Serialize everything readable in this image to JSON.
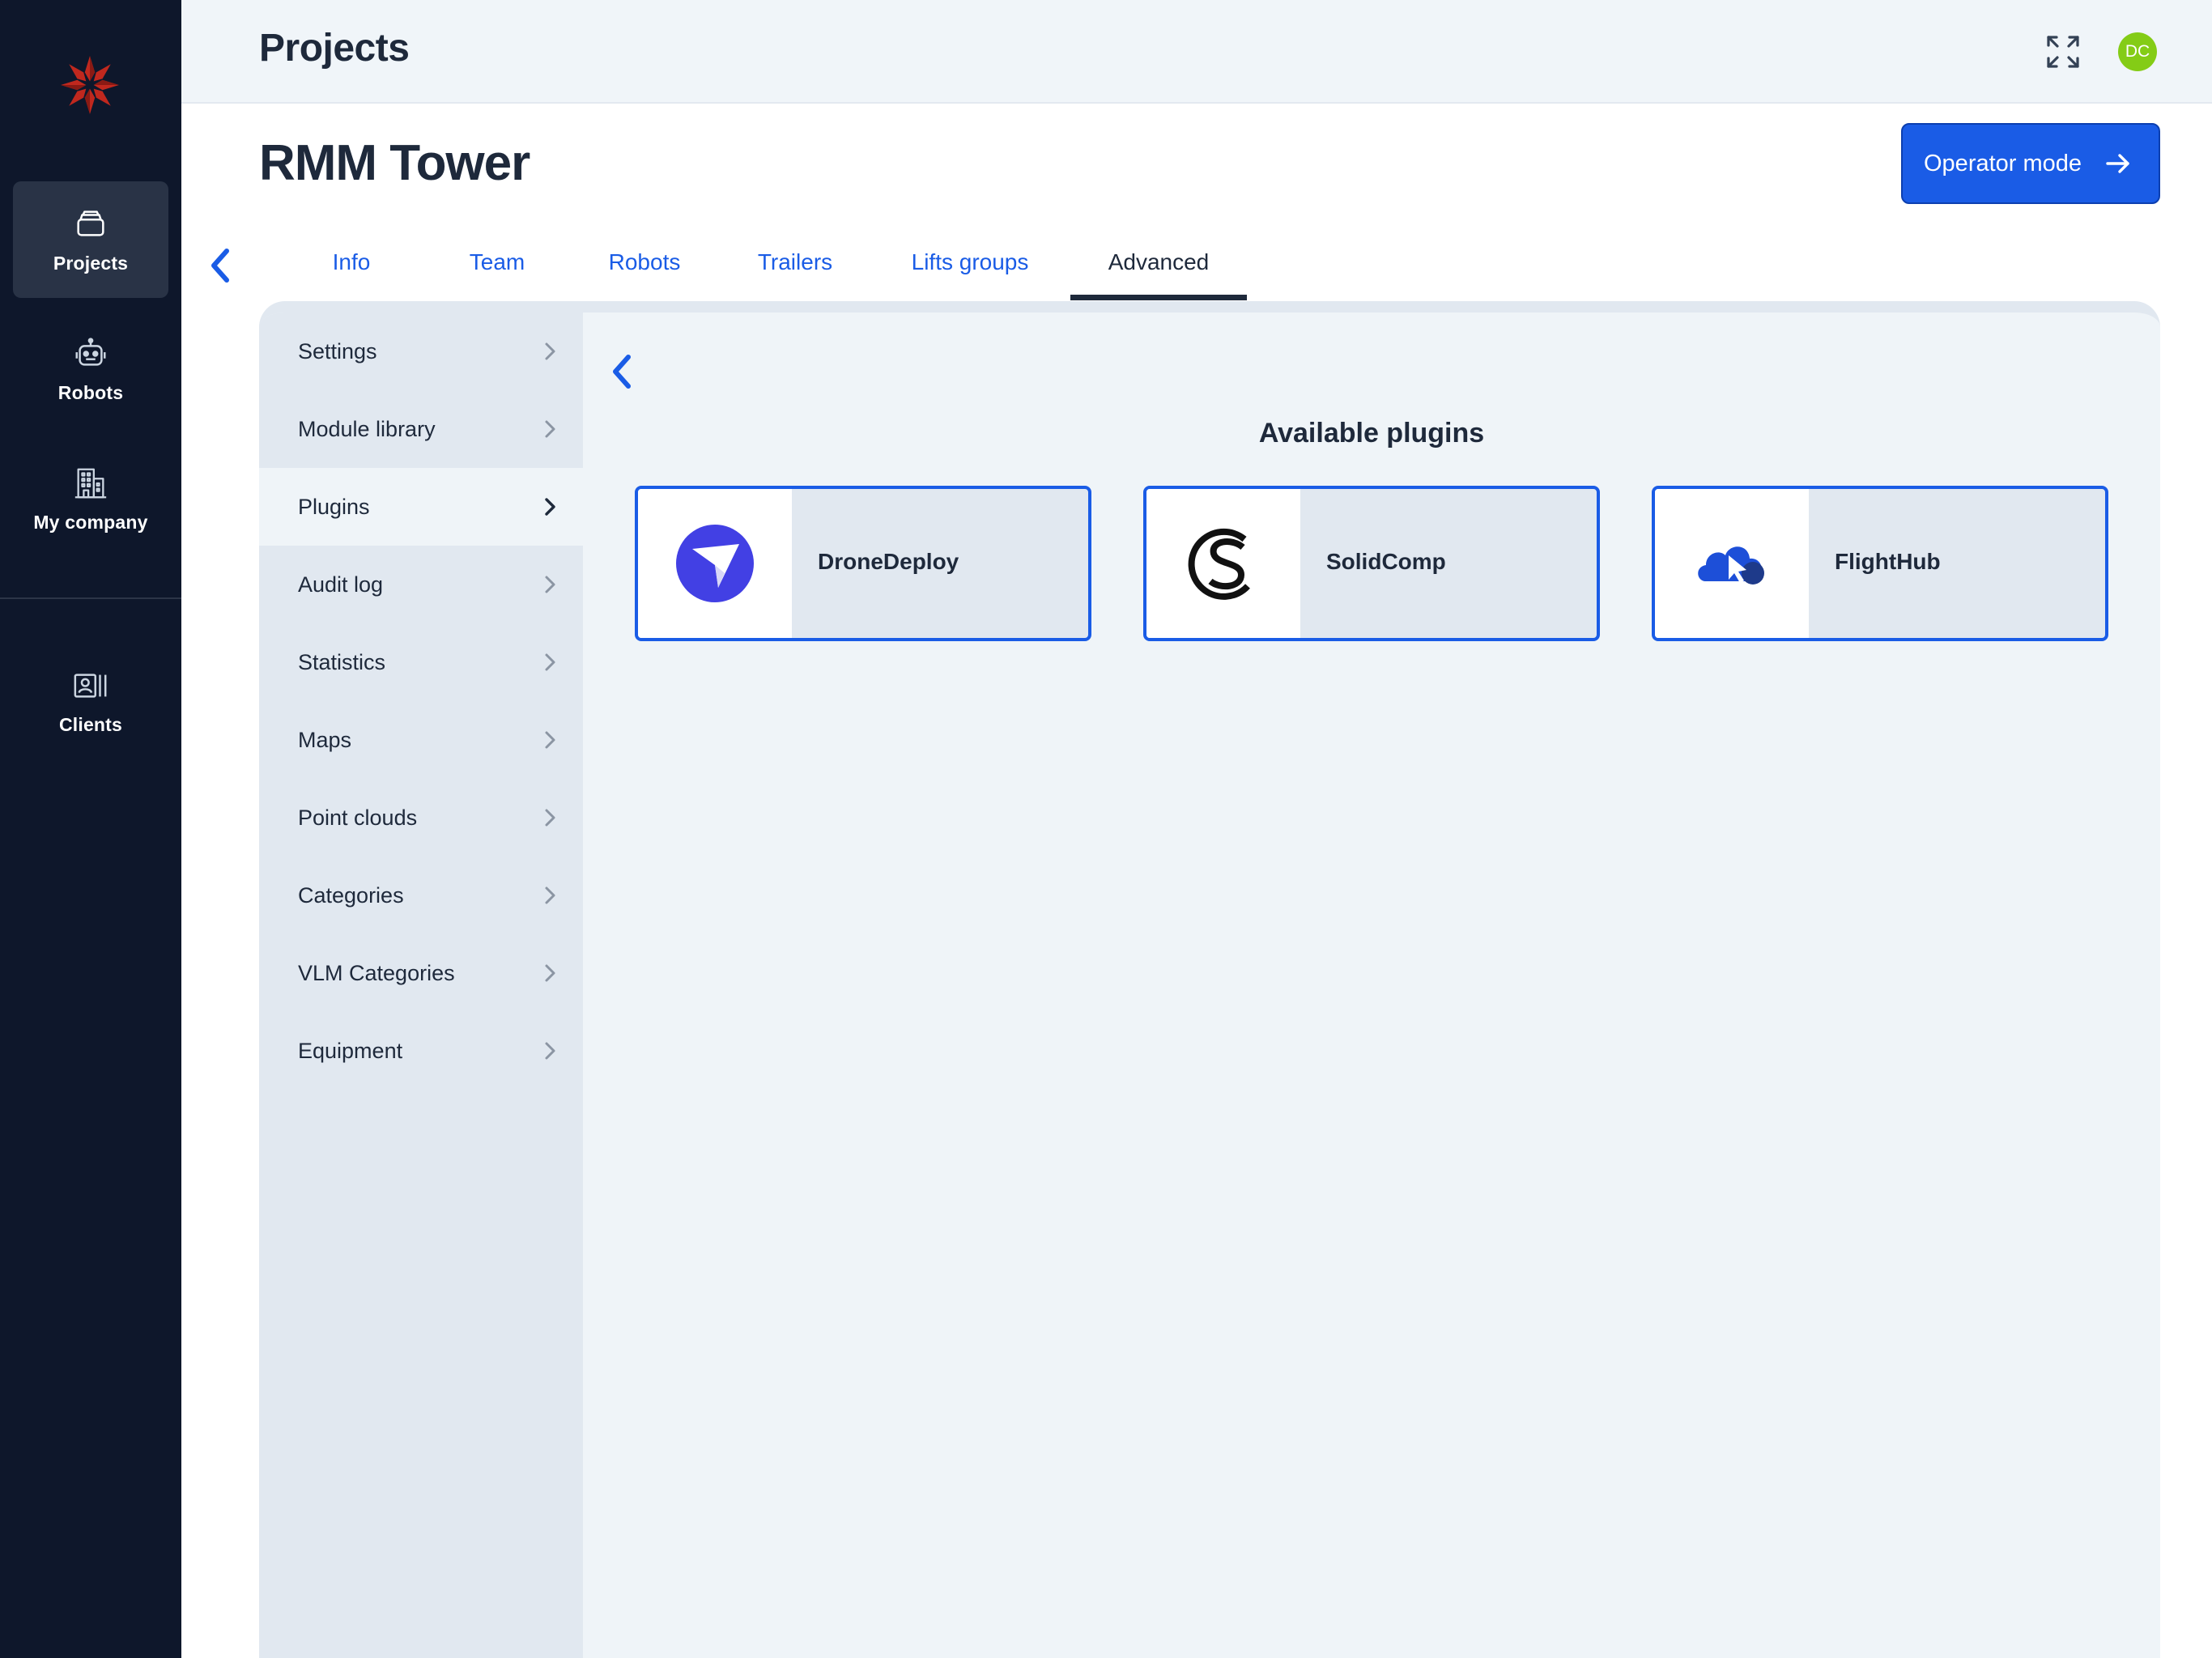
{
  "colors": {
    "rail_bg": "#0e172b",
    "accent": "#1a5ce6",
    "avatar_bg": "#84cc16",
    "logo_red": "#c0281e"
  },
  "rail": {
    "logo_icon": "snowflake-logo",
    "items": [
      {
        "label": "Projects",
        "icon": "folder-stack-icon",
        "active": true
      },
      {
        "label": "Robots",
        "icon": "robot-icon",
        "active": false
      },
      {
        "label": "My company",
        "icon": "building-icon",
        "active": false
      },
      {
        "label": "Clients",
        "icon": "contact-card-icon",
        "active": false
      }
    ]
  },
  "topbar": {
    "title": "Projects",
    "fullscreen_icon": "expand-icon",
    "avatar_initials": "DC"
  },
  "header": {
    "project_name": "RMM Tower",
    "operator_button": "Operator mode"
  },
  "tabs": [
    {
      "label": "Info",
      "active": false
    },
    {
      "label": "Team",
      "active": false
    },
    {
      "label": "Robots",
      "active": false
    },
    {
      "label": "Trailers",
      "active": false
    },
    {
      "label": "Lifts groups",
      "active": false
    },
    {
      "label": "Advanced",
      "active": true
    }
  ],
  "submenu": [
    {
      "label": "Settings",
      "active": false
    },
    {
      "label": "Module library",
      "active": false
    },
    {
      "label": "Plugins",
      "active": true
    },
    {
      "label": "Audit log",
      "active": false
    },
    {
      "label": "Statistics",
      "active": false
    },
    {
      "label": "Maps",
      "active": false
    },
    {
      "label": "Point clouds",
      "active": false
    },
    {
      "label": "Categories",
      "active": false
    },
    {
      "label": "VLM Categories",
      "active": false
    },
    {
      "label": "Equipment",
      "active": false
    }
  ],
  "plugins": {
    "heading": "Available plugins",
    "items": [
      {
        "name": "DroneDeploy",
        "icon": "dronedeploy-logo"
      },
      {
        "name": "SolidComp",
        "icon": "solidcomp-logo"
      },
      {
        "name": "FlightHub",
        "icon": "flighthub-logo"
      }
    ]
  }
}
